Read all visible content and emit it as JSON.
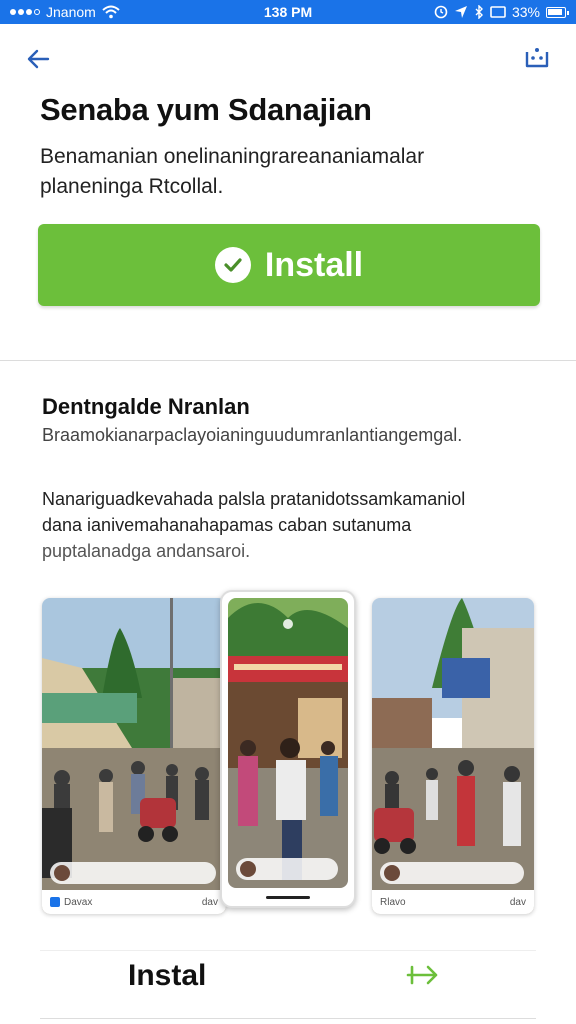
{
  "status_bar": {
    "carrier": "Jnanom",
    "time": "138 PM",
    "battery": "33%"
  },
  "app": {
    "title": "Senaba yum Sdanajian",
    "description": "Benamanian onelinaningrareananiamalar planeninga Rtcollal.",
    "install_label": "Install",
    "accent_color": "#6cbf3b",
    "brand_color": "#1a73e8"
  },
  "section": {
    "title": "Dentngalde Nranlan",
    "subtitle": "Braamokianarpaclayoianinguudumranlantiangemgal.",
    "body_lines": [
      "Nanariguadkevahada palsla pratanidotssamkamaniol",
      "dana ianivemahanahapamas caban sutanuma",
      "puptalanadga andansaroi."
    ]
  },
  "screenshots": {
    "left_footer": "Davax",
    "center_footer": "",
    "right_footer": "Rlavo",
    "left_footer_right": "dav",
    "right_footer_right": "dav"
  },
  "bottom": {
    "label": "Instal"
  },
  "icons": {
    "back": "arrow-left-icon",
    "menu": "grid-icon",
    "install": "check-circle-icon",
    "bottom_action": "arrow-right-icon"
  }
}
